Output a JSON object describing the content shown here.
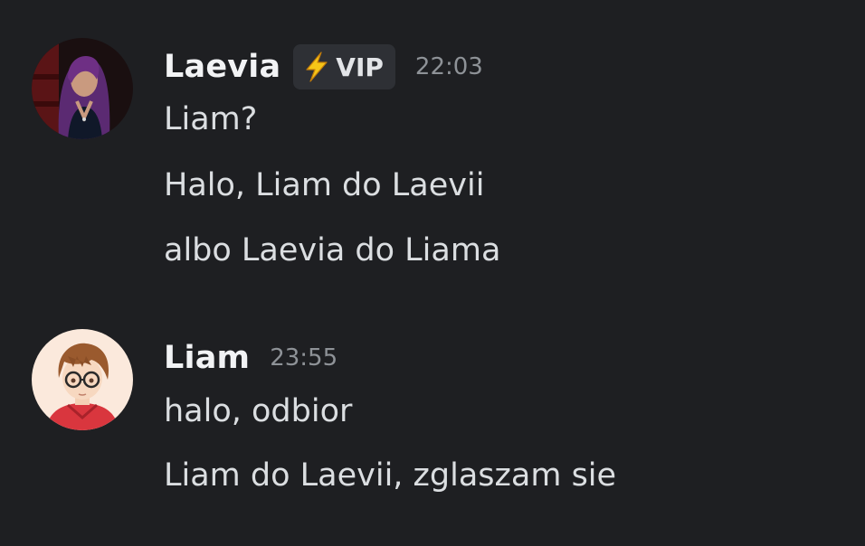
{
  "messages": [
    {
      "author": "Laevia",
      "badge": {
        "icon": "lightning-bolt-icon",
        "label": "VIP"
      },
      "timestamp": "22:03",
      "lines": [
        "Liam?",
        "Halo, Liam do Laevii",
        "albo Laevia do Liama"
      ]
    },
    {
      "author": "Liam",
      "timestamp": "23:55",
      "lines": [
        "halo, odbior",
        "Liam do Laevii, zglaszam sie"
      ]
    }
  ],
  "colors": {
    "background": "#1e1f22",
    "username": "#f2f3f5",
    "message_text": "#dbdee1",
    "timestamp": "#8e9297",
    "badge_background": "#2e3035",
    "bolt": "#f5c518"
  }
}
